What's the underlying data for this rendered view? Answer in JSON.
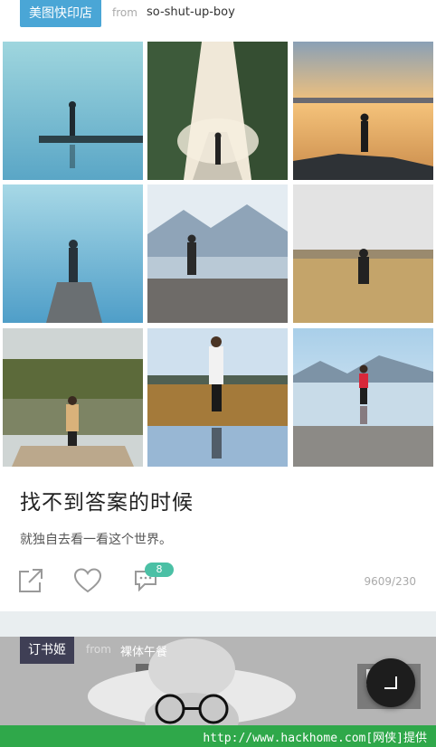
{
  "card1": {
    "store_badge": "美图快印店",
    "from_label": "from",
    "from_source": "so-shut-up-boy",
    "title": "找不到答案的时候",
    "subtitle": "就独自去看一看这个世界。",
    "comment_count": "8",
    "stats": "9609/230"
  },
  "card2": {
    "store_badge": "订书姬",
    "from_label": "from",
    "from_source": "裸体午餐"
  },
  "footer": {
    "text": "http://www.hackhome.com[网侠]提供"
  },
  "icons": [
    "share-icon",
    "heart-icon",
    "comment-icon",
    "floating-action-icon"
  ],
  "colors": {
    "store_badge_bg": "#4aa6d6",
    "comment_badge": "#4bc0a5",
    "book_badge_bg": "#3f3f55",
    "footer_bg": "#2fa84a"
  }
}
